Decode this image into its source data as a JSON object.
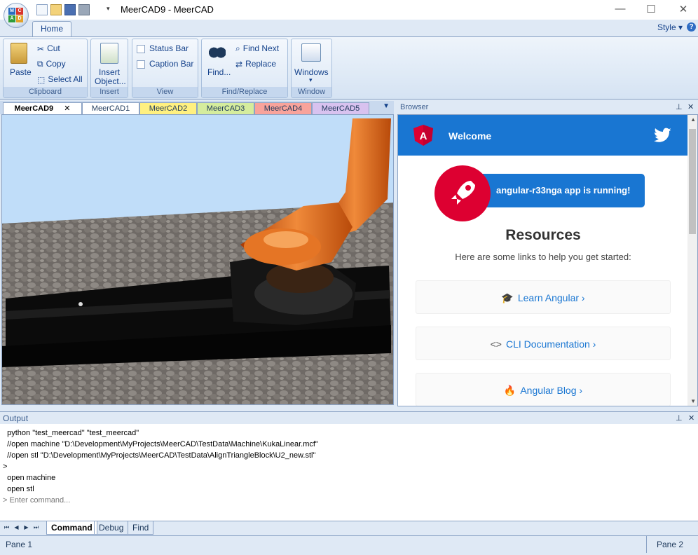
{
  "window": {
    "title": "MeerCAD9 - MeerCAD",
    "minimize": "—",
    "maximize": "☐",
    "close": "✕",
    "qat_more": "▾"
  },
  "app_logo_letters": [
    "M",
    "C",
    "A",
    "D"
  ],
  "ribbon": {
    "tabs": [
      {
        "label": "Home"
      }
    ],
    "style_label": "Style",
    "help_label": "?",
    "groups": {
      "clipboard": {
        "label": "Clipboard",
        "paste": "Paste",
        "cut": "Cut",
        "copy": "Copy",
        "select_all": "Select All"
      },
      "insert": {
        "label": "Insert",
        "insert_object_line1": "Insert",
        "insert_object_line2": "Object..."
      },
      "view": {
        "label": "View",
        "status_bar": "Status Bar",
        "caption_bar": "Caption Bar"
      },
      "find_replace": {
        "label": "Find/Replace",
        "find": "Find...",
        "find_next": "Find Next",
        "replace": "Replace"
      },
      "window": {
        "label": "Window",
        "windows": "Windows",
        "windows_arrow": "▾"
      }
    }
  },
  "document_tabs": [
    {
      "label": "MeerCAD9",
      "color": "#ffffff",
      "active": true,
      "close": "✕"
    },
    {
      "label": "MeerCAD1",
      "color": "#ffffff"
    },
    {
      "label": "MeerCAD2",
      "color": "#fff080"
    },
    {
      "label": "MeerCAD3",
      "color": "#d5ec9d"
    },
    {
      "label": "MeerCAD4",
      "color": "#f8a39b"
    },
    {
      "label": "MeerCAD5",
      "color": "#d8c2ef"
    }
  ],
  "tabs_menu": "▼",
  "browser": {
    "title": "Browser",
    "pin": "📌",
    "close": "✕",
    "header": {
      "welcome": "Welcome",
      "brand_color": "#1976d2",
      "logo_letter": "A"
    },
    "running_text": "angular-r33nga app is running!",
    "resources_title": "Resources",
    "resources_subtitle": "Here are some links to help you get started:",
    "cards": [
      {
        "icon": "graduation-cap-icon",
        "glyph": "🎓",
        "label": "Learn Angular",
        "chevron": "›"
      },
      {
        "icon": "code-icon",
        "glyph": "<>",
        "label": "CLI Documentation",
        "chevron": "›"
      },
      {
        "icon": "flame-icon",
        "glyph": "🔥",
        "label": "Angular Blog",
        "chevron": "›"
      }
    ]
  },
  "output": {
    "title": "Output",
    "pin": "📌",
    "close": "✕",
    "lines": [
      "  python \"test_meercad\" \"test_meercad\"",
      "  //open machine \"D:\\Development\\MyProjects\\MeerCAD\\TestData\\Machine\\KukaLinear.mcf\"",
      "  //open stl \"D:\\Development\\MyProjects\\MeerCAD\\TestData\\AlignTriangleBlock\\U2_new.stl\"",
      ">",
      "  open machine",
      "  open stl"
    ],
    "prompt": "> Enter command...",
    "tabs": [
      {
        "label": "Command",
        "active": true
      },
      {
        "label": "Debug"
      },
      {
        "label": "Find"
      }
    ],
    "nav": [
      "⏮",
      "◀",
      "▶",
      "⏭"
    ]
  },
  "status_bar": {
    "pane1": "Pane 1",
    "pane2": "Pane 2"
  }
}
